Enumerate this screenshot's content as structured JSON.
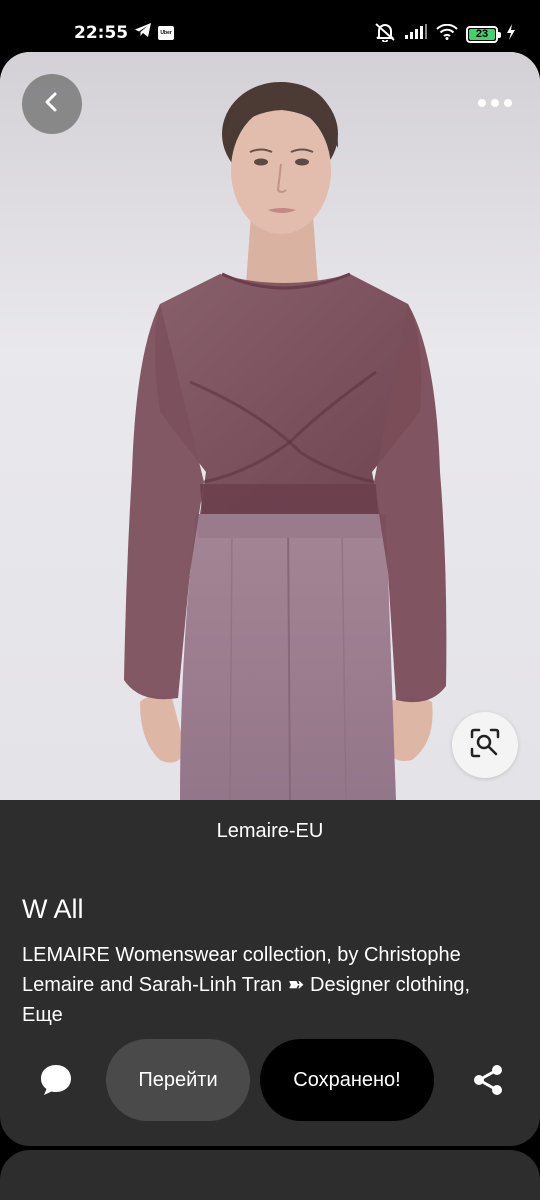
{
  "status_bar": {
    "time": "22:55",
    "app_badge": "Uber",
    "battery_level": "23",
    "icons": [
      "telegram-icon",
      "uber-icon",
      "alarm-off-icon",
      "signal-icon",
      "wifi-icon",
      "battery-icon",
      "charging-icon"
    ]
  },
  "pin": {
    "source": "Lemaire-EU",
    "title": "W All",
    "description": "LEMAIRE Womenswear collection, by Christophe Lemaire and Sarah-Linh Tran ➽ Designer clothing,",
    "more_label": "Еще"
  },
  "actions": {
    "visit_label": "Перейти",
    "saved_label": "Сохранено!"
  },
  "colors": {
    "card_bg": "#2d2d2d",
    "visit_bg": "#4a4a4a",
    "saved_bg": "#000000",
    "blouse": "#7a4a58",
    "trousers": "#9c7c8c",
    "backdrop": "#e8e7eb"
  }
}
